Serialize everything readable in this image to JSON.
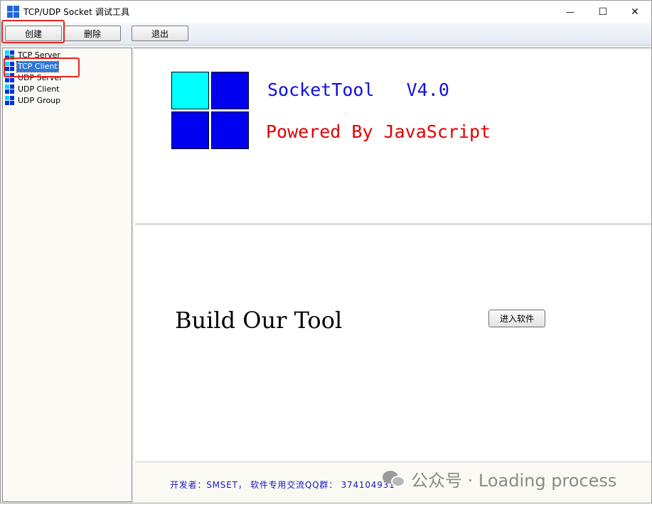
{
  "window": {
    "title": "TCP/UDP Socket 调试工具",
    "minimize_glyph": "—",
    "maximize_glyph": "☐",
    "close_glyph": "✕"
  },
  "toolbar": {
    "create_label": "创建",
    "delete_label": "删除",
    "exit_label": "退出"
  },
  "sidebar": {
    "items": [
      {
        "label": "TCP Server",
        "icon": "grid-icon"
      },
      {
        "label": "TCP Client",
        "icon": "grid-icon",
        "selected": true
      },
      {
        "label": "UDP Server",
        "icon": "grid-icon"
      },
      {
        "label": "UDP Client",
        "icon": "grid-icon"
      },
      {
        "label": "UDP Group",
        "icon": "grid-icon"
      }
    ]
  },
  "main": {
    "app_name": "SocketTool   V4.0",
    "powered_by": "Powered By JavaScript",
    "tagline": "Build Our Tool",
    "enter_button": "进入软件",
    "footer": "开发者：SMSET， 软件专用交流QQ群： 374104931"
  },
  "watermark": {
    "text": "公众号 · Loading process"
  },
  "colors": {
    "logo_cyan": "#00ffff",
    "logo_blue": "#0000f0",
    "title_blue": "#1010e0",
    "powered_red": "#e00000",
    "highlight_red": "#e8231f",
    "selection_blue": "#3077d6"
  }
}
